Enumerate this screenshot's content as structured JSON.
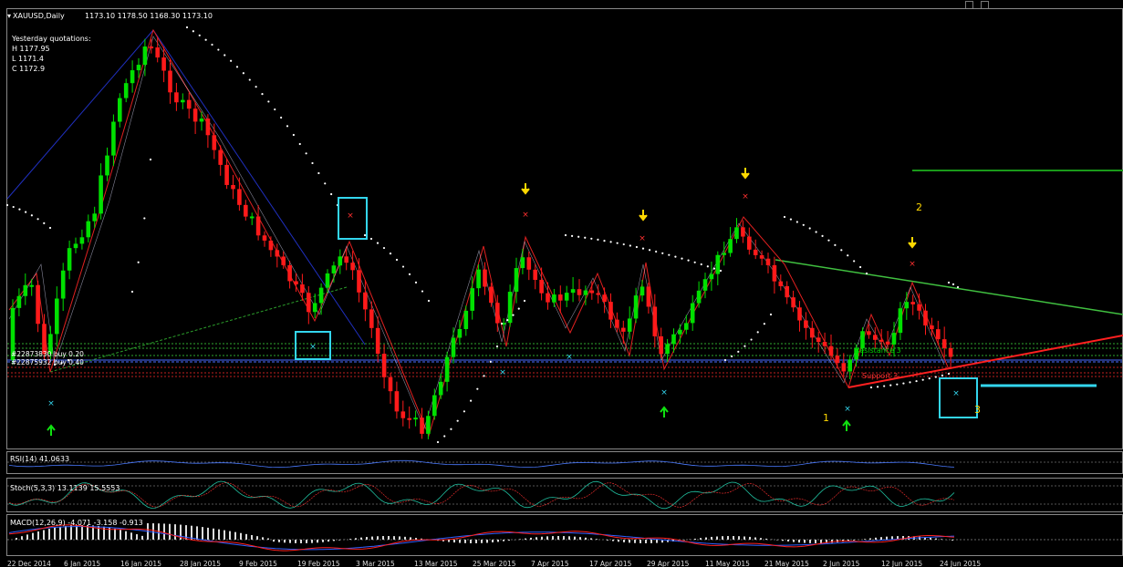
{
  "window": {
    "symbol_label": "XAUUSD,Daily",
    "ohlc_label": "1173.10 1178.50 1168.30 1173.10"
  },
  "quotes": {
    "title": "Yesterday quotations:",
    "high": "H 1177.95",
    "low": "L 1171.4",
    "close": "C 1172.9"
  },
  "orders": {
    "buy1": "#22873830 buy 0.20",
    "buy2": "#22875932 buy 0.40"
  },
  "levels": {
    "resistance": "Resistance 3",
    "support": "Support 3"
  },
  "wave_labels": {
    "one": "1",
    "two": "2",
    "three": "3"
  },
  "indicators": {
    "rsi": "RSI(14) 41.0633",
    "stoch": "Stoch(5,3,3) 13.1139 15.5553",
    "macd": "MACD(12,26,9) -4.071 -3.158 -0.913"
  },
  "dates": [
    "22 Dec 2014",
    "6 Jan 2015",
    "16 Jan 2015",
    "28 Jan 2015",
    "9 Feb 2015",
    "19 Feb 2015",
    "3 Mar 2015",
    "13 Mar 2015",
    "25 Mar 2015",
    "7 Apr 2015",
    "17 Apr 2015",
    "29 Apr 2015",
    "11 May 2015",
    "21 May 2015",
    "2 Jun 2015",
    "12 Jun 2015",
    "24 Jun 2015"
  ],
  "colors": {
    "bull": "#00e000",
    "bear": "#ff1a1a",
    "psar": "#ffffff",
    "highlight": "#33d6ee",
    "arrow_down": "#ffd800",
    "arrow_up": "#10e010"
  }
}
